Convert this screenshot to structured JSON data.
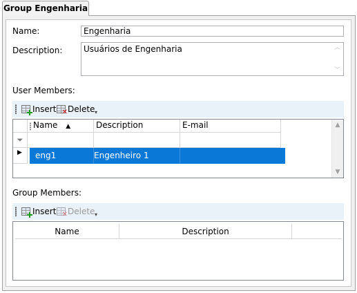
{
  "tab": {
    "title": "Group Engenharia"
  },
  "form": {
    "name_label": "Name:",
    "name_value": "Engenharia",
    "description_label": "Description:",
    "description_value": "Usuários de Engenharia"
  },
  "user_members": {
    "section_label": "User Members:",
    "toolbar": {
      "insert_label": "Insert",
      "delete_label": "Delete"
    },
    "columns": [
      "Name",
      "Description",
      "E-mail"
    ],
    "sort": {
      "column": "Name",
      "direction": "ascending"
    },
    "rows": [
      {
        "name": "eng1",
        "description": "Engenheiro 1",
        "email": "",
        "selected": true
      }
    ]
  },
  "group_members": {
    "section_label": "Group Members:",
    "toolbar": {
      "insert_label": "Insert",
      "delete_label": "Delete"
    },
    "columns": [
      "Name",
      "Description"
    ]
  },
  "colors": {
    "selection": "#0a78d7",
    "toolbar_bg": "#e9f1f9"
  }
}
